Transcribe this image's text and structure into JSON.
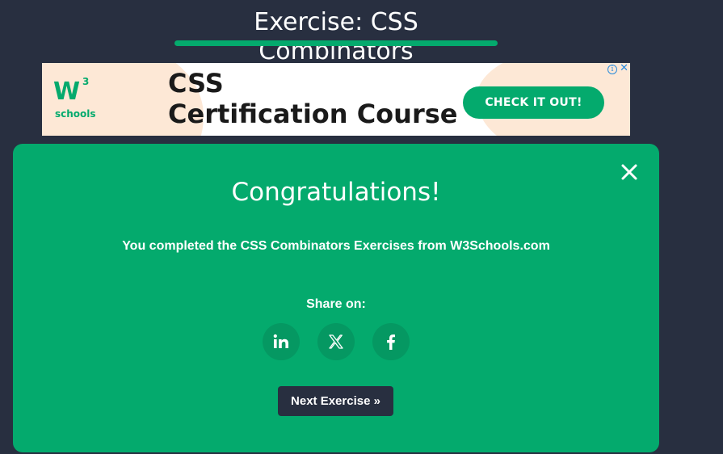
{
  "page": {
    "title": "Exercise: CSS Combinators"
  },
  "ad": {
    "logo_mark": "W",
    "logo_superscript": "3",
    "logo_text": "schools",
    "headline_line1": "CSS",
    "headline_line2": "Certification Course",
    "cta_label": "CHECK IT OUT!",
    "info_icon": "i",
    "close_icon": "✕"
  },
  "modal": {
    "heading": "Congratulations!",
    "message": "You completed the CSS Combinators Exercises from W3Schools.com",
    "share_label": "Share on:",
    "share_buttons": [
      "linkedin-icon",
      "x-icon",
      "facebook-icon"
    ],
    "next_label": "Next Exercise »",
    "close_icon": "close-icon"
  },
  "colors": {
    "background": "#282f40",
    "accent": "#04aa6d",
    "ad_peach": "#fde8d6"
  }
}
